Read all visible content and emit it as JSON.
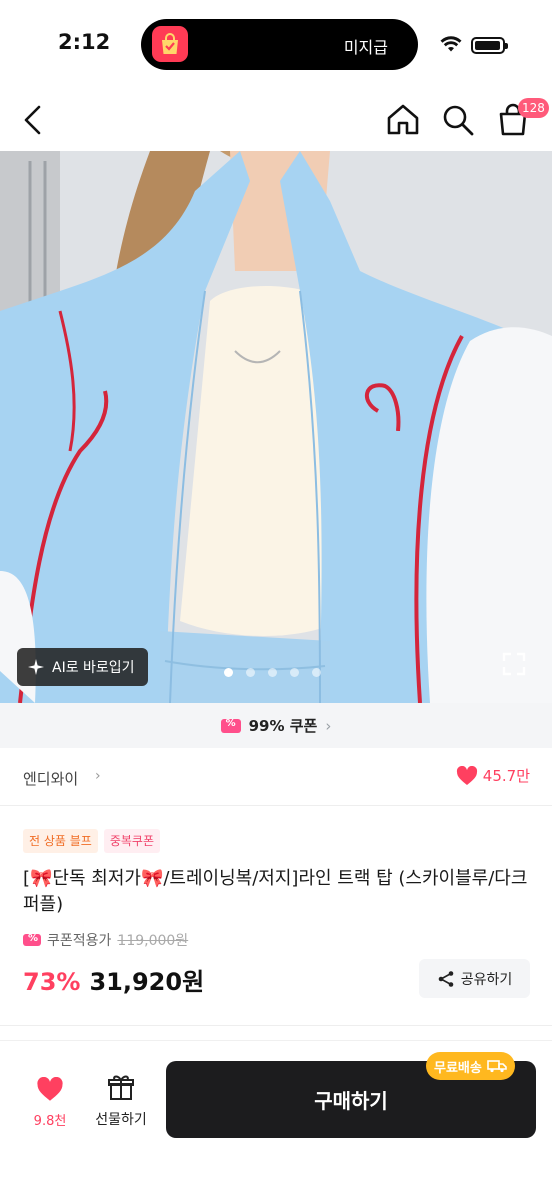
{
  "status_bar": {
    "time": "2:12",
    "island_label": "미지급"
  },
  "nav": {
    "cart_count": "128"
  },
  "hero": {
    "ai_button": "AI로 바로입기",
    "page_dots": 5,
    "active_dot": 1
  },
  "coupon_strip": {
    "label": "99% 쿠폰"
  },
  "brand": {
    "name": "엔디와이",
    "likes": "45.7만"
  },
  "product": {
    "tags": [
      "전 상품 블프",
      "중복쿠폰"
    ],
    "title": "[🎀단독 최저가🎀/트레이닝복/저지]라인 트랙 탑 (스카이블루/다크퍼플)",
    "coupon_price_label": "쿠폰적용가",
    "original_price": "119,000원",
    "discount": "73%",
    "price": "31,920원",
    "share_label": "공유하기"
  },
  "bottom_bar": {
    "wish_count": "9.8천",
    "gift_label": "선물하기",
    "buy_label": "구매하기",
    "free_shipping": "무료배송"
  },
  "colors": {
    "accent_pink": "#ff4060",
    "buy_button": "#1c1c1e",
    "free_ship_badge": "#ffb81f",
    "jacket_blue": "#a7d3f2"
  }
}
